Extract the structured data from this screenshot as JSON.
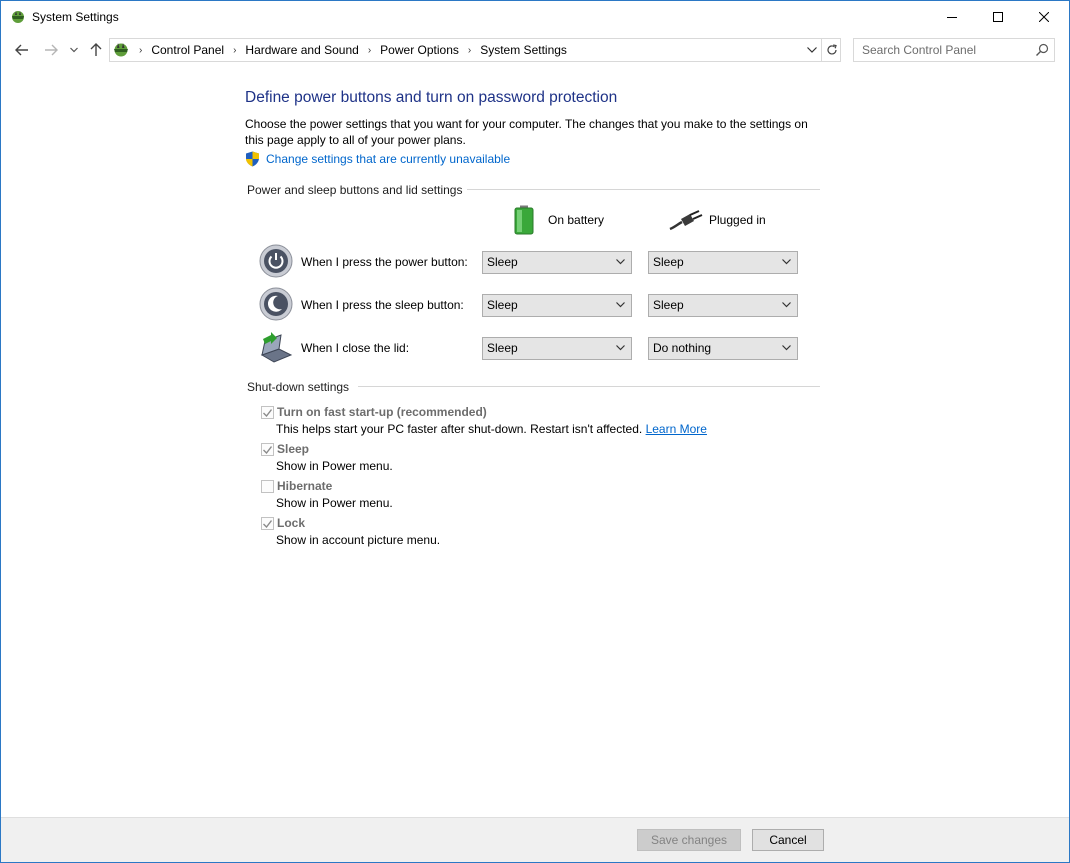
{
  "window": {
    "title": "System Settings"
  },
  "nav": {
    "breadcrumbs": [
      "Control Panel",
      "Hardware and Sound",
      "Power Options",
      "System Settings"
    ],
    "search_placeholder": "Search Control Panel"
  },
  "page": {
    "heading": "Define power buttons and turn on password protection",
    "description": "Choose the power settings that you want for your computer. The changes that you make to the settings on this page apply to all of your power plans.",
    "change_link": "Change settings that are currently unavailable"
  },
  "power_section": {
    "title": "Power and sleep buttons and lid settings",
    "col_battery": "On battery",
    "col_plugged": "Plugged in",
    "rows": [
      {
        "label": "When I press the power button:",
        "battery": "Sleep",
        "plugged": "Sleep"
      },
      {
        "label": "When I press the sleep button:",
        "battery": "Sleep",
        "plugged": "Sleep"
      },
      {
        "label": "When I close the lid:",
        "battery": "Sleep",
        "plugged": "Do nothing"
      }
    ]
  },
  "shutdown_section": {
    "title": "Shut-down settings",
    "items": [
      {
        "label": "Turn on fast start-up (recommended)",
        "desc": "This helps start your PC faster after shut-down. Restart isn't affected.",
        "checked": true,
        "link": "Learn More"
      },
      {
        "label": "Sleep",
        "desc": "Show in Power menu.",
        "checked": true
      },
      {
        "label": "Hibernate",
        "desc": "Show in Power menu.",
        "checked": false
      },
      {
        "label": "Lock",
        "desc": "Show in account picture menu.",
        "checked": true
      }
    ]
  },
  "footer": {
    "save_label": "Save changes",
    "cancel_label": "Cancel"
  },
  "colors": {
    "heading": "#1e3287",
    "link": "#0066cc",
    "window_border": "#2b78c5"
  }
}
